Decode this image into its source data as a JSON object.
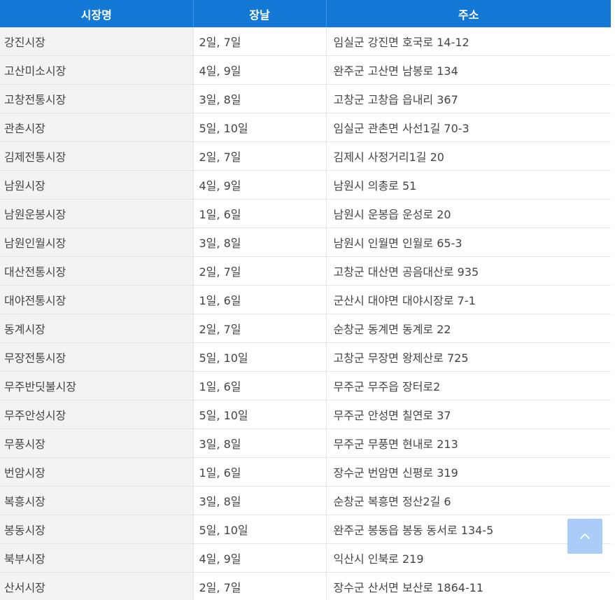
{
  "table": {
    "headers": [
      "시장명",
      "장날",
      "주소"
    ],
    "rows": [
      {
        "name": "강진시장",
        "days": "2일, 7일",
        "address": "임실군 강진면 호국로 14-12"
      },
      {
        "name": "고산미소시장",
        "days": "4일, 9일",
        "address": "완주군 고산면  남봉로 134"
      },
      {
        "name": "고창전통시장",
        "days": "3일, 8일",
        "address": "고창군 고창읍 읍내리 367"
      },
      {
        "name": "관촌시장",
        "days": "5일, 10일",
        "address": "임실군 관촌면 사선1길 70-3"
      },
      {
        "name": "김제전통시장",
        "days": "2일, 7일",
        "address": "김제시 사정거리1길 20"
      },
      {
        "name": "남원시장",
        "days": "4일, 9일",
        "address": "남원시 의총로 51"
      },
      {
        "name": "남원운봉시장",
        "days": "1일, 6일",
        "address": "남원시 운봉읍 운성로 20"
      },
      {
        "name": "남원인월시장",
        "days": "3일, 8일",
        "address": "남원시 인월면 인월로 65-3"
      },
      {
        "name": "대산전통시장",
        "days": "2일, 7일",
        "address": "고창군 대산면 공음대산로 935"
      },
      {
        "name": "대야전통시장",
        "days": "1일, 6일",
        "address": "군산시 대야면 대야시장로 7-1"
      },
      {
        "name": "동계시장",
        "days": "2일, 7일",
        "address": "순창군 동계면 동계로 22"
      },
      {
        "name": "무장전통시장",
        "days": "5일, 10일",
        "address": "고창군 무장면 왕제산로 725"
      },
      {
        "name": "무주반딧불시장",
        "days": "1일, 6일",
        "address": "무주군 무주읍 장터로2"
      },
      {
        "name": "무주안성시장",
        "days": "5일, 10일",
        "address": "무주군 안성면 칠연로 37"
      },
      {
        "name": "무풍시장",
        "days": "3일, 8일",
        "address": "무주군 무풍면 현내로 213"
      },
      {
        "name": "번암시장",
        "days": "1일, 6일",
        "address": "장수군 번암면 신평로 319"
      },
      {
        "name": "복흥시장",
        "days": "3일, 8일",
        "address": "순창군 복흥면 정산2길 6"
      },
      {
        "name": "봉동시장",
        "days": "5일, 10일",
        "address": "완주군 봉동읍 봉동 동서로 134-5"
      },
      {
        "name": "북부시장",
        "days": "4일, 9일",
        "address": "익산시 인북로 219"
      },
      {
        "name": "산서시장",
        "days": "2일, 7일",
        "address": "장수군 산서면 보산로 1864-11"
      }
    ]
  },
  "scroll_top": {
    "icon": "chevron-up-icon"
  },
  "colors": {
    "header_bg": "#1479d6",
    "header_text": "#ffffff",
    "name_cell_bg": "#f3f3f3",
    "scroll_top_bg": "#a9cdf7"
  }
}
